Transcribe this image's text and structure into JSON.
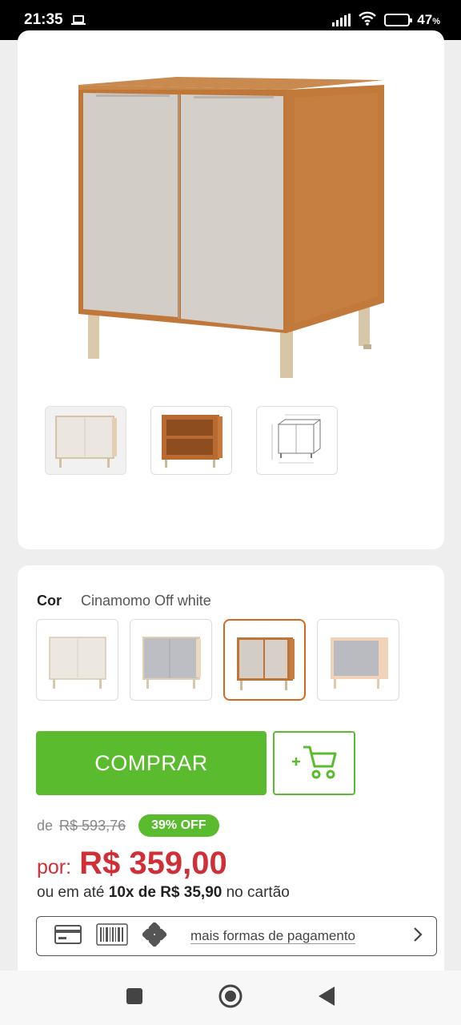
{
  "status_bar": {
    "time": "21:35",
    "battery_percent": "47",
    "battery_unit": "%",
    "battery_level": 0.47,
    "icons": [
      "laptop-icon",
      "signal-icon",
      "wifi-icon",
      "battery-icon"
    ]
  },
  "product_gallery": {
    "main_image": "cabinet-cinamomo-off-white",
    "thumbnails": [
      "cabinet-off-white-thumbnail",
      "cabinet-open-shelves-thumbnail",
      "cabinet-dimensions-drawing-thumbnail"
    ],
    "active_thumbnail": 0
  },
  "color": {
    "label": "Cor",
    "selected_value": "Cinamomo Off white",
    "swatches": [
      "off-white",
      "gray-light-wood",
      "cinamomo-off-white",
      "gray-pine"
    ],
    "selected_index": 2,
    "selected_border_color": "#d2691e"
  },
  "buy": {
    "button_label": "COMPRAR",
    "add_to_cart_icon": "add-to-cart-icon",
    "accent_color": "#5bbb2f"
  },
  "pricing": {
    "old_price_prefix": "de",
    "old_price": "R$ 593,76",
    "discount_badge": "39% OFF",
    "price_prefix": "por:",
    "price": "R$ 359,00",
    "price_color": "#d12f37",
    "installment_prefix": "ou em até",
    "installment_terms": "10x de R$ 35,90",
    "installment_suffix": "no cartão"
  },
  "payment": {
    "link_text": "mais formas de pagamento",
    "icons": [
      "credit-card-icon",
      "barcode-icon",
      "pix-icon"
    ]
  },
  "nav_bar": {
    "icons": [
      "recents-icon",
      "home-icon",
      "back-icon"
    ]
  }
}
